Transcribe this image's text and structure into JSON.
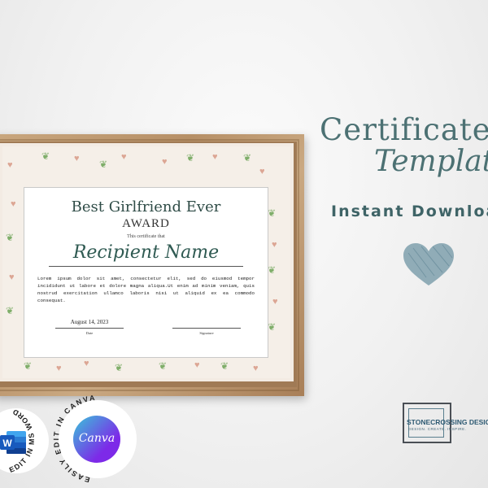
{
  "certificate": {
    "title": "Best Girlfriend Ever",
    "award": "AWARD",
    "subtitle": "This certificate that",
    "recipient": "Recipient Name",
    "body": "Lorem ipsum dolor sit amet, consectetur elit, sed do eiusmod tempor incididunt ut labore et dolore magna aliqua.Ut enim ad minim veniam, quis nostrud exercitation ullamco laboris nisi ut aliquid ex ea commodo consequat.",
    "date": "August 14, 2023",
    "date_label": "Date",
    "signature_label": "Signature"
  },
  "heading": {
    "line1": "Certificate",
    "line2": "Template",
    "line3": "Instant Download"
  },
  "badges": {
    "word_text": "EDIT IN MS WORD",
    "word_letter": "W",
    "canva_text": "EASILY EDIT IN CANVA",
    "canva_logo": "Canva"
  },
  "brand": {
    "name": "STONECROSSING DESIGNS",
    "tagline": "DESIGN. CREATE. INSPIRE."
  },
  "colors": {
    "heading": "#4c7173",
    "heart": "#7fa0ad",
    "frame": "#b68f66",
    "canva": "#7d2ae8",
    "word": "#185abd"
  },
  "icons": {
    "big_heart": "heart-icon",
    "word": "ms-word-icon",
    "canva": "canva-logo-icon"
  }
}
